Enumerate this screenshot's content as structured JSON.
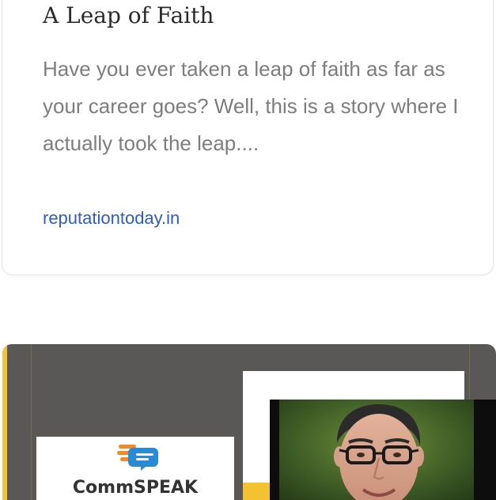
{
  "card": {
    "title": "A Leap of Faith",
    "description": "Have you ever taken a leap of faith as far as your career goes? Well, this is a story where I actually took the leap....",
    "source_link": "reputationtoday.in"
  },
  "preview_image": {
    "logo_text": "CommSPEAK",
    "logo_icon": "speech-bubbles-icon",
    "colors": {
      "background": "#5a5856",
      "accent_yellow": "#f1c533",
      "logo_orange": "#f08a24",
      "logo_blue": "#2a8bd4"
    }
  }
}
